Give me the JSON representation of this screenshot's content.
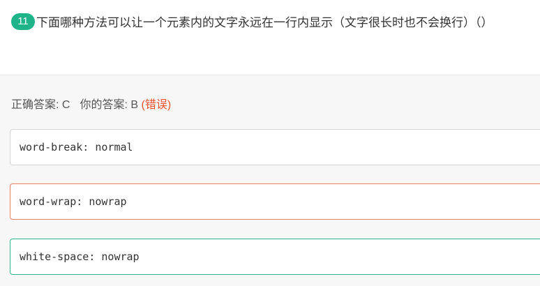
{
  "question": {
    "number": "11",
    "text": "下面哪种方法可以让一个元素内的文字永远在一行内显示（文字很长时也不会换行）（）"
  },
  "answer": {
    "correct_label": "正确答案: C",
    "user_label": "你的答案: B",
    "wrong_tag": "(错误)"
  },
  "options": [
    {
      "text": "word-break: normal",
      "state": "normal"
    },
    {
      "text": "word-wrap: nowrap",
      "state": "wrong"
    },
    {
      "text": "white-space: nowrap",
      "state": "correct"
    }
  ],
  "colors": {
    "badge": "#1fb38a",
    "wrong": "#e8552d",
    "wrong_border": "#e8826a",
    "correct_border": "#2fb496"
  }
}
